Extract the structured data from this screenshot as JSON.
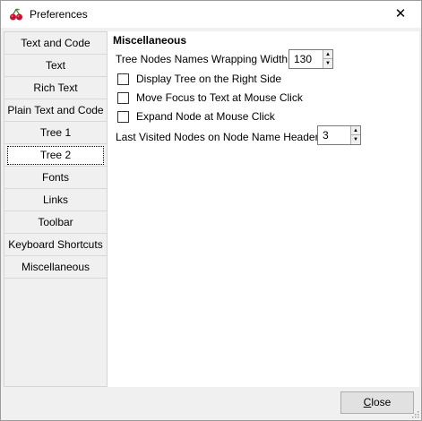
{
  "window": {
    "title": "Preferences",
    "close_glyph": "✕"
  },
  "sidebar": {
    "items": [
      {
        "label": "Text and Code"
      },
      {
        "label": "Text"
      },
      {
        "label": "Rich Text"
      },
      {
        "label": "Plain Text and Code"
      },
      {
        "label": "Tree 1"
      },
      {
        "label": "Tree 2",
        "selected": true
      },
      {
        "label": "Fonts"
      },
      {
        "label": "Links"
      },
      {
        "label": "Toolbar"
      },
      {
        "label": "Keyboard Shortcuts"
      },
      {
        "label": "Miscellaneous"
      }
    ]
  },
  "panel": {
    "section_title": "Miscellaneous",
    "wrap_width_label": "Tree Nodes Names Wrapping Width",
    "wrap_width_value": "130",
    "display_right_label": "Display Tree on the Right Side",
    "display_right_checked": false,
    "move_focus_label": "Move Focus to Text at Mouse Click",
    "move_focus_checked": false,
    "expand_node_label": "Expand Node at Mouse Click",
    "expand_node_checked": false,
    "last_visited_label": "Last Visited Nodes on Node Name Header",
    "last_visited_value": "3"
  },
  "footer": {
    "close_label_first": "C",
    "close_label_rest": "lose"
  },
  "colors": {
    "content_bg": "#ffffff",
    "chrome_bg": "#f0f0f0",
    "cherry_red": "#c8102e"
  },
  "icons": {
    "app": "cherry-icon",
    "spin_up": "triangle-up-icon",
    "spin_down": "triangle-down-icon"
  }
}
